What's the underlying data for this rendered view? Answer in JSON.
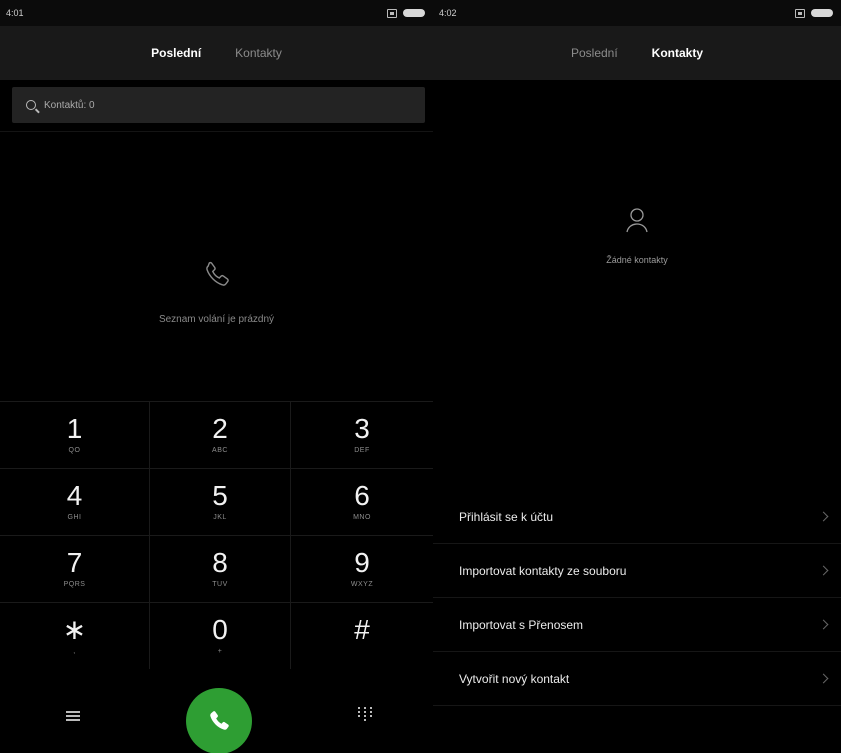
{
  "left": {
    "status": {
      "time": "4:01"
    },
    "tabs": [
      {
        "label": "Poslední",
        "active": true
      },
      {
        "label": "Kontakty",
        "active": false
      }
    ],
    "search": {
      "text": "Kontaktů: 0"
    },
    "empty_message": "Seznam volání je prázdný",
    "keypad": [
      {
        "digit": "1",
        "letters": "QO"
      },
      {
        "digit": "2",
        "letters": "ABC"
      },
      {
        "digit": "3",
        "letters": "DEF"
      },
      {
        "digit": "4",
        "letters": "GHI"
      },
      {
        "digit": "5",
        "letters": "JKL"
      },
      {
        "digit": "6",
        "letters": "MNO"
      },
      {
        "digit": "7",
        "letters": "PQRS"
      },
      {
        "digit": "8",
        "letters": "TUV"
      },
      {
        "digit": "9",
        "letters": "WXYZ"
      },
      {
        "digit": "∗",
        "letters": ","
      },
      {
        "digit": "0",
        "letters": "+"
      },
      {
        "digit": "#",
        "letters": ""
      }
    ],
    "footer": {
      "call_color": "#2e9e33"
    }
  },
  "right": {
    "status": {
      "time": "4:02"
    },
    "tabs": [
      {
        "label": "Poslední",
        "active": false
      },
      {
        "label": "Kontakty",
        "active": true
      }
    ],
    "empty_message": "Žádné kontakty",
    "actions": [
      {
        "label": "Přihlásit se k účtu"
      },
      {
        "label": "Importovat kontakty ze souboru"
      },
      {
        "label": "Importovat s Přenosem"
      },
      {
        "label": "Vytvořit nový kontakt"
      }
    ]
  }
}
